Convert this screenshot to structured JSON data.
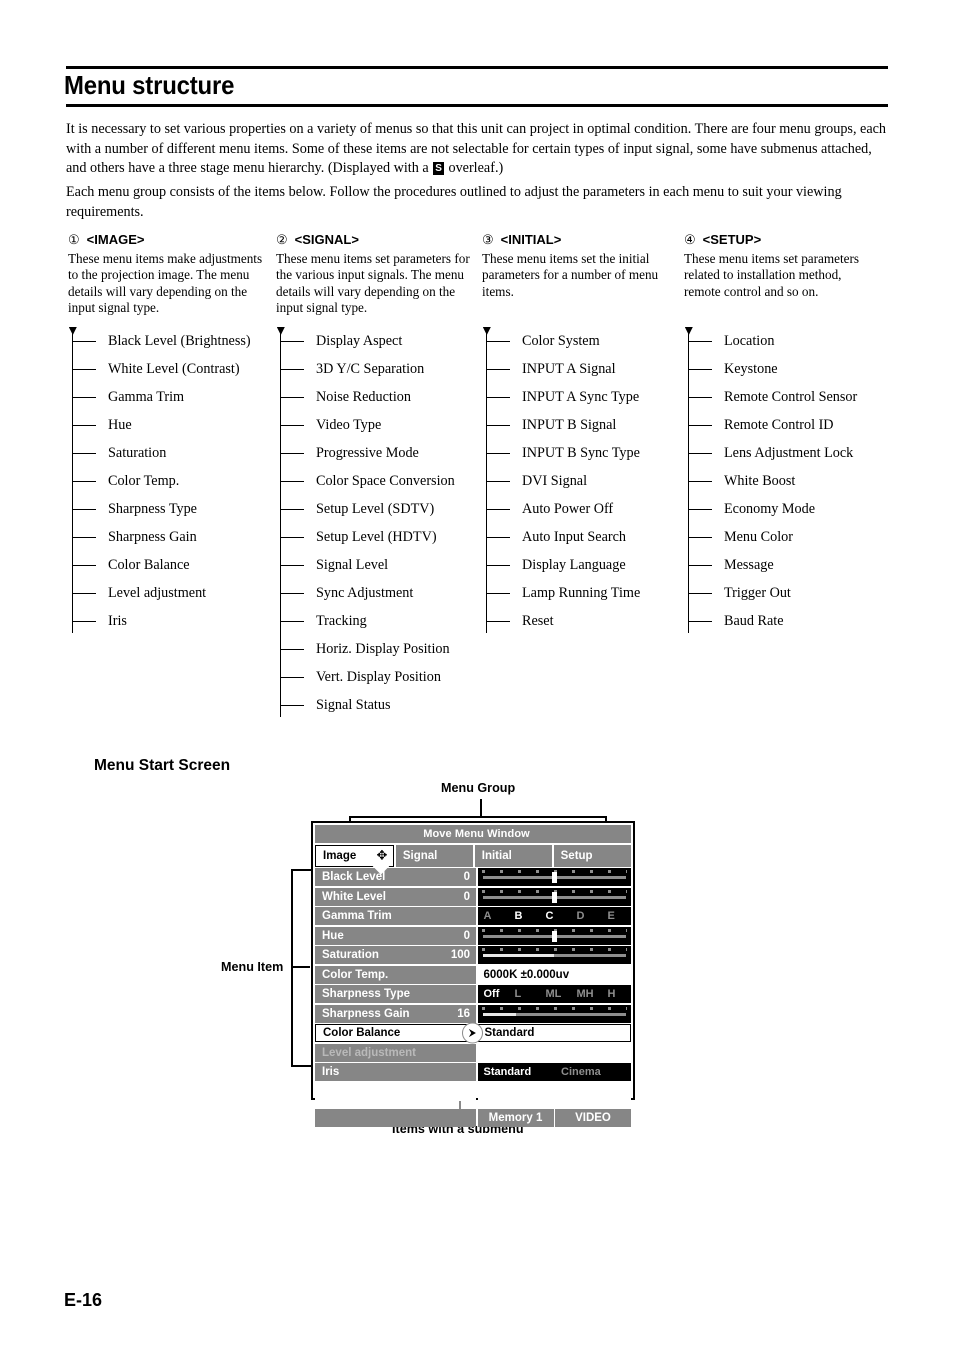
{
  "page": {
    "title": "Menu structure",
    "page_number": "E-16"
  },
  "intro": {
    "p1_a": "It is necessary to set various properties on a variety of menus so that this unit can project in optimal condition. There are four menu groups, each with a number of different menu items. Some of these items are not selectable for certain types of input signal, some have submenus attached, and others have a three stage menu hierarchy. (Displayed with a ",
    "p1_badge": "S",
    "p1_b": " overleaf.)",
    "p2": "Each menu group consists of the items below. Follow the procedures outlined to adjust the parameters in each menu to suit your viewing requirements."
  },
  "groups": [
    {
      "number": "①",
      "name": "<IMAGE>",
      "description": "These menu items make adjustments to the projection image. The menu details will vary depending on the input signal type.",
      "items": [
        "Black Level (Brightness)",
        "White Level (Contrast)",
        "Gamma Trim",
        "Hue",
        "Saturation",
        "Color Temp.",
        "Sharpness Type",
        "Sharpness Gain",
        "Color Balance",
        "Level adjustment",
        "Iris"
      ]
    },
    {
      "number": "②",
      "name": "<SIGNAL>",
      "description": "These menu items set parameters for the various input signals. The menu details will vary depending on the input signal type.",
      "items": [
        "Display Aspect",
        "3D Y/C Separation",
        "Noise Reduction",
        "Video Type",
        "Progressive Mode",
        "Color Space Conversion",
        "Setup Level (SDTV)",
        "Setup Level (HDTV)",
        "Signal Level",
        "Sync Adjustment",
        "Tracking",
        "Horiz. Display Position",
        "Vert. Display Position",
        "Signal Status"
      ]
    },
    {
      "number": "③",
      "name": "<INITIAL>",
      "description": "These menu items set the initial parameters for a number of menu items.",
      "items": [
        "Color System",
        "INPUT A Signal",
        "INPUT A Sync Type",
        "INPUT B Signal",
        "INPUT B Sync Type",
        "DVI Signal",
        "Auto Power Off",
        "Auto Input Search",
        "Display Language",
        "Lamp Running Time",
        "Reset"
      ]
    },
    {
      "number": "④",
      "name": "<SETUP>",
      "description": "These menu items set parameters related to installation method, remote control and so on.",
      "items": [
        "Location",
        "Keystone",
        "Remote Control Sensor",
        "Remote Control ID",
        "Lens Adjustment Lock",
        "White Boost",
        "Economy Mode",
        "Menu Color",
        "Message",
        "Trigger Out",
        "Baud Rate"
      ]
    }
  ],
  "menu_start_screen": {
    "heading": "Menu Start Screen",
    "callouts": {
      "menu_group": "Menu Group",
      "menu_item": "Menu Item",
      "submenu": "Items with a submenu"
    },
    "osd": {
      "titlebar": "Move Menu Window",
      "tabs": [
        {
          "label": "Image",
          "selected": true,
          "icon": "move-arrows-icon"
        },
        {
          "label": "Signal",
          "selected": false
        },
        {
          "label": "Initial",
          "selected": false
        },
        {
          "label": "Setup",
          "selected": false
        }
      ],
      "rows": [
        {
          "label": "Black Level",
          "value": "0",
          "control": "slider",
          "knob_pct": 50,
          "fill_pct": 0
        },
        {
          "label": "White Level",
          "value": "0",
          "control": "slider",
          "knob_pct": 50,
          "fill_pct": 0
        },
        {
          "label": "Gamma Trim",
          "value": "",
          "control": "segments",
          "segments": [
            "A",
            "B",
            "C",
            "D",
            "E"
          ],
          "on": [
            1,
            2
          ]
        },
        {
          "label": "Hue",
          "value": "0",
          "control": "slider",
          "knob_pct": 50,
          "fill_pct": 0
        },
        {
          "label": "Saturation",
          "value": "100",
          "control": "bar",
          "fill_pct": 50
        },
        {
          "label": "Color Temp.",
          "value": "",
          "control": "text",
          "text": "6000K  ±0.000uv"
        },
        {
          "label": "Sharpness Type",
          "value": "",
          "control": "segments",
          "segments": [
            "Off",
            "L",
            "ML",
            "MH",
            "H"
          ],
          "on": [
            0
          ]
        },
        {
          "label": "Sharpness Gain",
          "value": "16",
          "control": "bar",
          "fill_pct": 25
        },
        {
          "label": "Color Balance",
          "value": "",
          "control": "text-box",
          "text": "Standard",
          "selected": true,
          "submenu": true
        },
        {
          "label": "Level adjustment",
          "value": "",
          "control": "empty",
          "dim": true
        },
        {
          "label": "Iris",
          "value": "",
          "control": "segments2",
          "segments": [
            "Standard",
            "Cinema"
          ],
          "on": [
            0
          ]
        }
      ],
      "footer": {
        "memory": "Memory 1",
        "input": "VIDEO"
      }
    }
  }
}
